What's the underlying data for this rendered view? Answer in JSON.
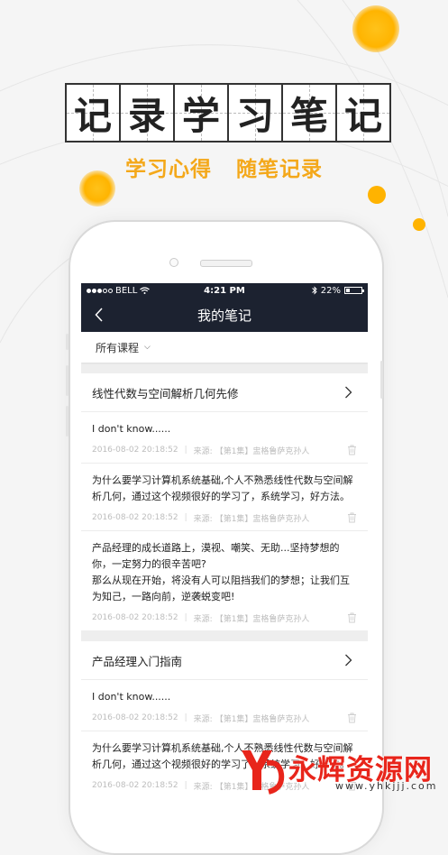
{
  "promo": {
    "title_chars": [
      "记",
      "录",
      "学",
      "习",
      "笔",
      "记"
    ],
    "subtitle": "学习心得   随笔记录"
  },
  "status_bar": {
    "carrier": "BELL",
    "time": "4:21 PM",
    "battery": "22%"
  },
  "nav": {
    "title": "我的笔记"
  },
  "filter": {
    "label": "所有课程"
  },
  "courses": [
    {
      "title": "线性代数与空间解析几何先修",
      "notes": [
        {
          "text": "I don't know......",
          "date": "2016-08-02 20:18:52",
          "source_label": "来源:",
          "source": "【第1集】盅格鲁萨克孙人"
        },
        {
          "text": "为什么要学习计算机系统基础,个人不熟悉线性代数与空间解析几何，通过这个视频很好的学习了，系统学习，好方法。",
          "date": "2016-08-02 20:18:52",
          "source_label": "来源:",
          "source": "【第1集】盅格鲁萨克孙人"
        },
        {
          "text": "产品经理的成长道路上，漠视、嘲笑、无助...坚持梦想的你，一定努力的很辛苦吧?\n那么从现在开始，将没有人可以阻挡我们的梦想；让我们互为知己，一路向前，逆袭蜕变吧!",
          "date": "2016-08-02 20:18:52",
          "source_label": "来源:",
          "source": "【第1集】盅格鲁萨克孙人"
        }
      ]
    },
    {
      "title": "产品经理入门指南",
      "notes": [
        {
          "text": "I don't know......",
          "date": "2016-08-02 20:18:52",
          "source_label": "来源:",
          "source": "【第1集】盅格鲁萨克孙人"
        },
        {
          "text": "为什么要学习计算机系统基础,个人不熟悉线性代数与空间解析几何，通过这个视频很好的学习了，系统学习，好方法。",
          "date": "2016-08-02 20:18:52",
          "source_label": "来源:",
          "source": "【第1集】盅格鲁萨克孙人"
        }
      ]
    }
  ],
  "watermark": {
    "text": "永辉资源网",
    "url": "www.yhkjjj.com"
  },
  "colors": {
    "accent": "#f4a81a",
    "navbar": "#1c2230",
    "watermark": "#e8251b"
  }
}
